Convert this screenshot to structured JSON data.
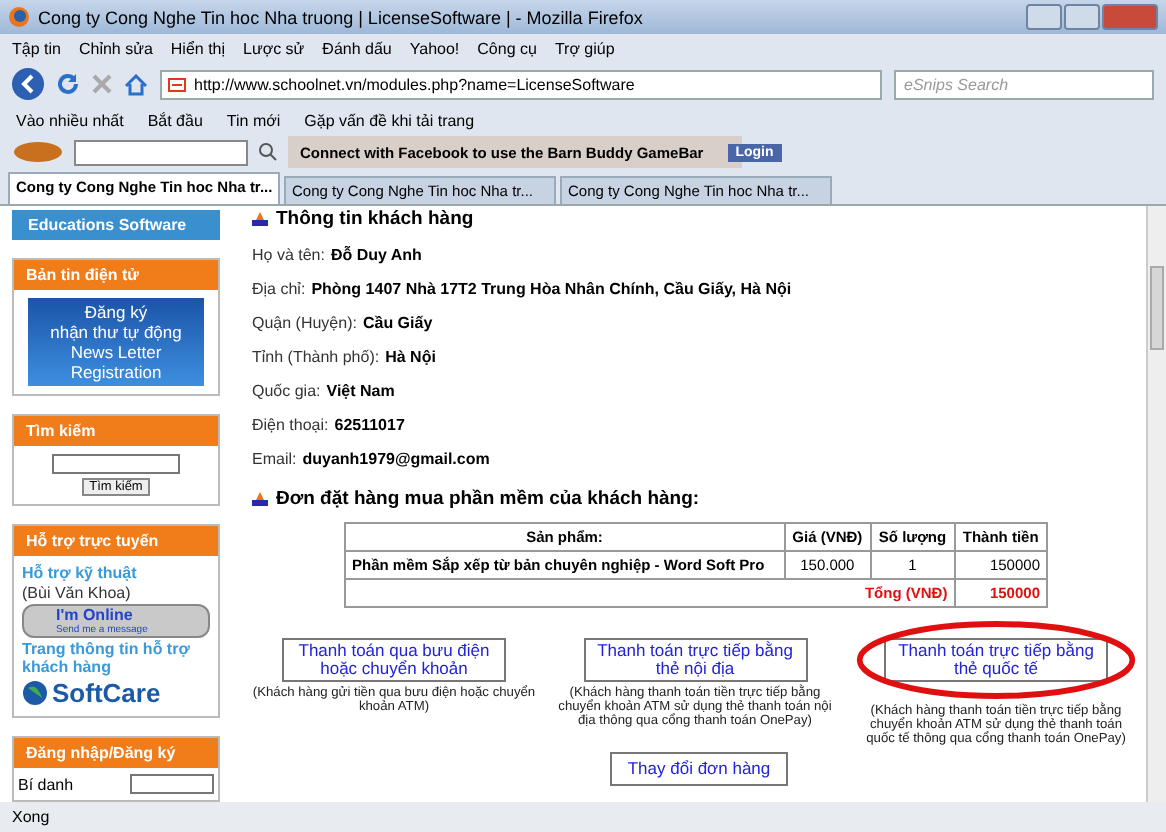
{
  "window": {
    "title": "Cong ty Cong Nghe Tin hoc Nha truong | LicenseSoftware | - Mozilla Firefox"
  },
  "menu": [
    "Tập tin",
    "Chỉnh sửa",
    "Hiển thị",
    "Lược sử",
    "Đánh dấu",
    "Yahoo!",
    "Công cụ",
    "Trợ giúp"
  ],
  "nav": {
    "url": "http://www.schoolnet.vn/modules.php?name=LicenseSoftware",
    "search_placeholder": "eSnips Search"
  },
  "bookmarks": [
    "Vào nhiều nhất",
    "Bắt đầu",
    "Tin mới",
    "Gặp vấn đề khi tải trang"
  ],
  "gamebar": {
    "message": "Connect with Facebook to use the Barn Buddy GameBar",
    "login": "Login"
  },
  "tabs": [
    {
      "label": "Cong ty Cong Nghe Tin hoc Nha tr...",
      "selected": true
    },
    {
      "label": "Cong ty Cong Nghe Tin hoc Nha tr...",
      "selected": false
    },
    {
      "label": "Cong ty Cong Nghe Tin hoc Nha tr...",
      "selected": false
    }
  ],
  "sidebar": [
    {
      "kind": "header",
      "title": "Educations Software"
    },
    {
      "kind": "newsletter",
      "title": "Bản tin điện tử",
      "lines": [
        "Đăng ký",
        "nhận thư tự động",
        "News Letter",
        "Registration"
      ]
    },
    {
      "kind": "search",
      "title": "Tìm kiếm",
      "button": "Tìm kiếm"
    },
    {
      "kind": "support",
      "title": "Hỗ trợ trực tuyến",
      "tech_link": "Hỗ trợ kỹ thuật",
      "contact": "(Bùi Văn Khoa)",
      "status": "I'm Online",
      "status_sub": "Send me a message",
      "info_link": "Trang thông tin hỗ trợ khách hàng",
      "brand": "SoftCare"
    },
    {
      "kind": "login",
      "title": "Đăng nhập/Đăng ký",
      "field_label": "Bí danh"
    }
  ],
  "customer": {
    "heading": "Thông tin khách hàng",
    "fields": [
      {
        "label": "Họ và tên:",
        "value": "Đỗ Duy Anh"
      },
      {
        "label": "Địa chỉ:",
        "value": "Phòng 1407 Nhà 17T2 Trung Hòa Nhân Chính, Cầu Giấy, Hà Nội"
      },
      {
        "label": "Quận (Huyện):",
        "value": "Cầu Giấy"
      },
      {
        "label": "Tỉnh (Thành phố):",
        "value": "Hà Nội"
      },
      {
        "label": "Quốc gia:",
        "value": "Việt Nam"
      },
      {
        "label": "Điện thoại:",
        "value": "62511017"
      },
      {
        "label": "Email:",
        "value": "duyanh1979@gmail.com"
      }
    ]
  },
  "order": {
    "heading": "Đơn đặt hàng mua phần mềm của khách hàng:",
    "columns": [
      "Sản phẩm:",
      "Giá (VNĐ)",
      "Số lượng",
      "Thành tiền"
    ],
    "rows": [
      {
        "product": "Phần mềm Sắp xếp từ bản chuyên nghiệp - Word Soft Pro",
        "price": "150.000",
        "qty": "1",
        "total": "150000"
      }
    ],
    "total_label": "Tổng (VNĐ)",
    "total": "150000"
  },
  "payments": [
    {
      "label": "Thanh toán qua bưu điện hoặc chuyển khoản",
      "note": "(Khách hàng gửi tiền qua bưu điện hoặc chuyển khoản ATM)",
      "circled": false
    },
    {
      "label": "Thanh toán trực tiếp bằng thẻ nội địa",
      "note": "(Khách hàng thanh toán tiền trực tiếp bằng chuyển khoản ATM sử dụng thẻ thanh toán nội địa thông qua cổng thanh toán OnePay)",
      "circled": false
    },
    {
      "label": "Thanh toán trực tiếp bằng thẻ quốc tế",
      "note": "(Khách hàng thanh toán tiền trực tiếp bằng chuyển khoản ATM sử dụng thẻ thanh toán quốc tế thông qua cổng thanh toán OnePay)",
      "circled": true
    }
  ],
  "change_button": "Thay đổi đơn hàng",
  "status_bar": "Xong"
}
